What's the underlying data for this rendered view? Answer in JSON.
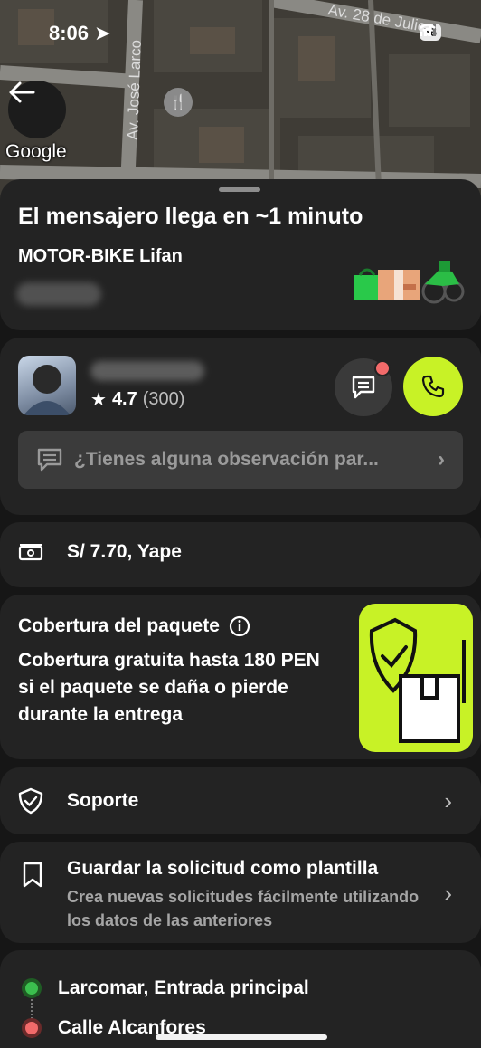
{
  "status_bar": {
    "time": "8:06",
    "battery": "56"
  },
  "map": {
    "attribution": "Google",
    "streets": [
      "Av. 28 de Julio",
      "Av. José Larco"
    ]
  },
  "trip": {
    "eta_title": "El mensajero llega en ~1 minuto",
    "vehicle": "MOTOR-BIKE Lifan"
  },
  "courier": {
    "rating": "4.7",
    "rating_count": "(300)"
  },
  "observation": {
    "placeholder": "¿Tienes alguna observación par..."
  },
  "payment": {
    "label": "S/ 7.70, Yape"
  },
  "coverage": {
    "title": "Cobertura del paquete",
    "body": "Cobertura gratuita hasta 180 PEN si el paquete se daña o pierde durante la entrega"
  },
  "support": {
    "label": "Soporte"
  },
  "template": {
    "title": "Guardar la solicitud como plantilla",
    "subtitle": "Crea nuevas solicitudes fácilmente utilizando los datos de las anteriores"
  },
  "route": {
    "pickup": "Larcomar, Entrada principal",
    "dropoff": "Calle Alcanfores"
  },
  "colors": {
    "accent": "#c8f226",
    "card": "#232323",
    "background": "#161616",
    "pickup": "#3bbf4e",
    "dropoff": "#f26a6a"
  }
}
